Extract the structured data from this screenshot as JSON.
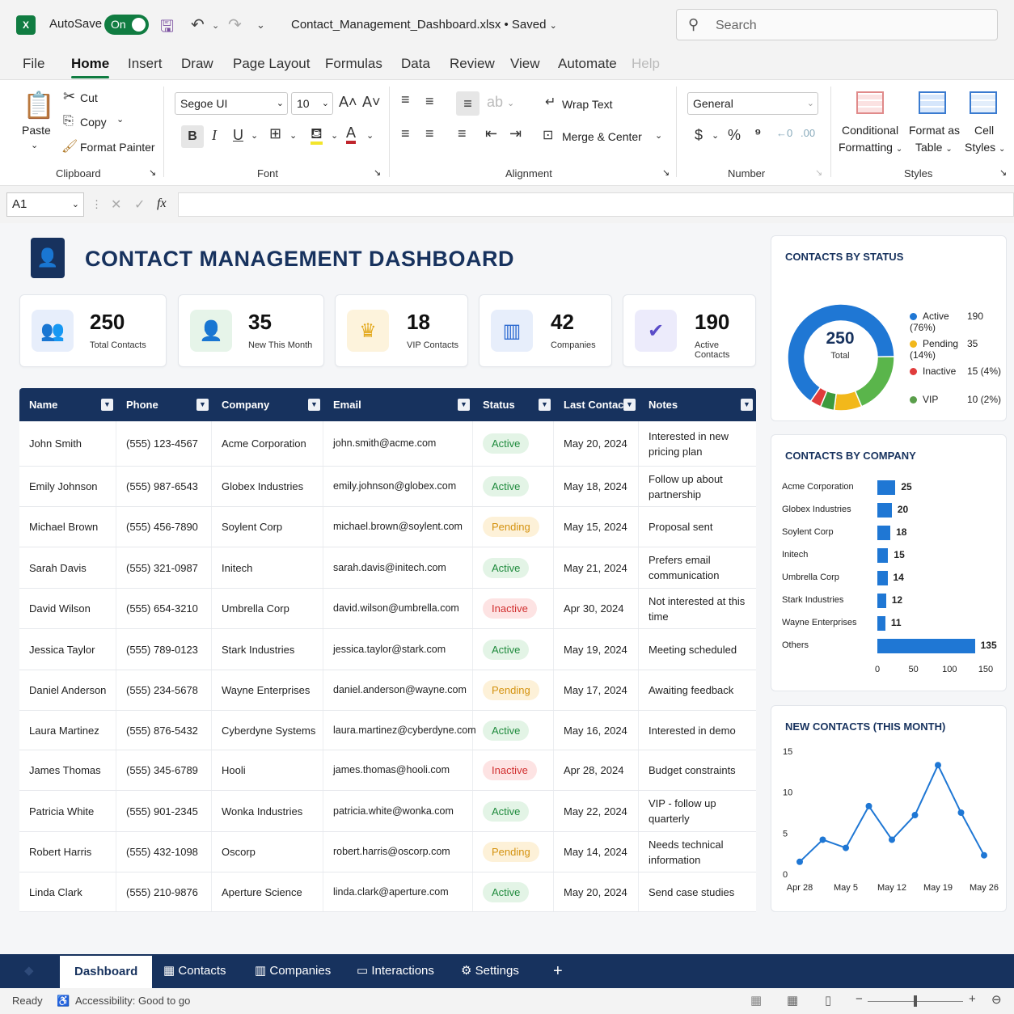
{
  "titlebar": {
    "app_icon": "X",
    "autosave_label": "AutoSave",
    "autosave_state": "On",
    "doc_title": "Contact_Management_Dashboard.xlsx • Saved",
    "search_placeholder": "Search"
  },
  "menu": [
    "File",
    "Home",
    "Insert",
    "Draw",
    "Page Layout",
    "Formulas",
    "Data",
    "Review",
    "View",
    "Automate",
    "Help"
  ],
  "ribbon": {
    "clipboard": {
      "paste": "Paste",
      "cut": "Cut",
      "copy": "Copy",
      "format_painter": "Format Painter",
      "label": "Clipboard"
    },
    "font": {
      "family": "Segoe UI",
      "size": "10",
      "label": "Font"
    },
    "alignment": {
      "wrap_text": "Wrap Text",
      "merge_center": "Merge & Center",
      "label": "Alignment"
    },
    "number": {
      "format": "General",
      "label": "Number"
    },
    "styles": {
      "conditional_1": "Conditional",
      "conditional_2": "Formatting",
      "format_table_1": "Format as",
      "format_table_2": "Table",
      "cell_styles_1": "Cell",
      "cell_styles_2": "Styles",
      "label": "Styles"
    }
  },
  "formula_bar": {
    "name_box": "A1",
    "fx": "fx",
    "value": ""
  },
  "dashboard": {
    "title": "CONTACT MANAGEMENT DASHBOARD",
    "kpis": [
      {
        "value": "250",
        "label": "Total Contacts",
        "icon": "users-icon"
      },
      {
        "value": "35",
        "label": "New This Month",
        "icon": "user-add-icon"
      },
      {
        "value": "18",
        "label": "VIP Contacts",
        "icon": "crown-icon"
      },
      {
        "value": "42",
        "label": "Companies",
        "icon": "building-icon"
      },
      {
        "value": "190",
        "label": "Active Contacts",
        "icon": "check-circle-icon"
      }
    ]
  },
  "table": {
    "headers": [
      "Name",
      "Phone",
      "Company",
      "Email",
      "Status",
      "Last Contact",
      "Notes"
    ],
    "rows": [
      [
        "John Smith",
        "(555) 123-4567",
        "Acme Corporation",
        "john.smith@acme.com",
        "Active",
        "May 20, 2024",
        "Interested in new pricing plan"
      ],
      [
        "Emily Johnson",
        "(555) 987-6543",
        "Globex Industries",
        "emily.johnson@globex.com",
        "Active",
        "May 18, 2024",
        "Follow up about partnership"
      ],
      [
        "Michael Brown",
        "(555) 456-7890",
        "Soylent Corp",
        "michael.brown@soylent.com",
        "Pending",
        "May 15, 2024",
        "Proposal sent"
      ],
      [
        "Sarah Davis",
        "(555) 321-0987",
        "Initech",
        "sarah.davis@initech.com",
        "Active",
        "May 21, 2024",
        "Prefers email communication"
      ],
      [
        "David Wilson",
        "(555) 654-3210",
        "Umbrella Corp",
        "david.wilson@umbrella.com",
        "Inactive",
        "Apr 30, 2024",
        "Not interested at this time"
      ],
      [
        "Jessica Taylor",
        "(555) 789-0123",
        "Stark Industries",
        "jessica.taylor@stark.com",
        "Active",
        "May 19, 2024",
        "Meeting scheduled"
      ],
      [
        "Daniel Anderson",
        "(555) 234-5678",
        "Wayne Enterprises",
        "daniel.anderson@wayne.com",
        "Pending",
        "May 17, 2024",
        "Awaiting feedback"
      ],
      [
        "Laura Martinez",
        "(555) 876-5432",
        "Cyberdyne Systems",
        "laura.martinez@cyberdyne.com",
        "Active",
        "May 16, 2024",
        "Interested in demo"
      ],
      [
        "James Thomas",
        "(555) 345-6789",
        "Hooli",
        "james.thomas@hooli.com",
        "Inactive",
        "Apr 28, 2024",
        "Budget constraints"
      ],
      [
        "Patricia White",
        "(555) 901-2345",
        "Wonka Industries",
        "patricia.white@wonka.com",
        "Active",
        "May 22, 2024",
        "VIP - follow up quarterly"
      ],
      [
        "Robert Harris",
        "(555) 432-1098",
        "Oscorp",
        "robert.harris@oscorp.com",
        "Pending",
        "May 14, 2024",
        "Needs technical information"
      ],
      [
        "Linda Clark",
        "(555) 210-9876",
        "Aperture Science",
        "linda.clark@aperture.com",
        "Active",
        "May 20, 2024",
        "Send case studies"
      ]
    ]
  },
  "chart_data": [
    {
      "type": "pie",
      "title": "CONTACTS BY STATUS",
      "center_value": "250",
      "center_label": "Total",
      "categories": [
        "Active",
        "Pending",
        "Inactive",
        "VIP"
      ],
      "values": [
        190,
        35,
        15,
        10
      ],
      "value_labels": [
        "190 (76%)",
        "35 (14%)",
        "15 (4%)",
        "10 (2%)"
      ],
      "colors": [
        "#1f77d4",
        "#f2b81b",
        "#e03c3c",
        "#5a9e4b"
      ],
      "ring_colors": [
        "#1f77d4",
        "#5ab54b",
        "#f2b81b",
        "#3d9a3d",
        "#e03c3c"
      ],
      "ring_values": [
        155,
        45,
        20,
        10,
        8
      ]
    },
    {
      "type": "bar",
      "title": "CONTACTS BY COMPANY",
      "orientation": "horizontal",
      "categories": [
        "Acme Corporation",
        "Globex Industries",
        "Soylent Corp",
        "Initech",
        "Umbrella Corp",
        "Stark Industries",
        "Wayne Enterprises",
        "Others"
      ],
      "values": [
        25,
        20,
        18,
        15,
        14,
        12,
        11,
        135
      ],
      "xlim": [
        0,
        150
      ],
      "xticks": [
        "0",
        "50",
        "100",
        "150"
      ],
      "color": "#1f77d4"
    },
    {
      "type": "line",
      "title": "NEW CONTACTS (THIS MONTH)",
      "x": [
        0,
        1,
        2,
        3,
        4,
        5,
        6,
        7,
        8
      ],
      "values": [
        1.5,
        4.2,
        3.2,
        8.3,
        4.2,
        7.2,
        13.3,
        7.5,
        2.3
      ],
      "ylim": [
        0,
        15
      ],
      "yticks": [
        "15",
        "10",
        "5",
        "0"
      ],
      "xticks": [
        "Apr 28",
        "May 5",
        "May 12",
        "May 19",
        "May 26"
      ],
      "color": "#1f77d4"
    }
  ],
  "sheets": [
    "Dashboard",
    "Contacts",
    "Companies",
    "Interactions",
    "Settings"
  ],
  "status": {
    "ready": "Ready",
    "accessibility": "Accessibility: Good to go"
  },
  "colors": {
    "navy": "#17325e",
    "excel_green": "#107c41",
    "accent_blue": "#1f77d4"
  }
}
